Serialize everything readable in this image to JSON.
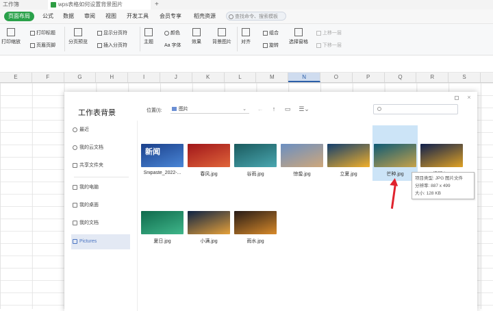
{
  "titlebar": {
    "tabs": [
      {
        "label": "工作簿"
      },
      {
        "label": "wps表格如何设置背景图片"
      }
    ],
    "new_tab": "+"
  },
  "menubar": {
    "items": [
      {
        "label": "页面布局",
        "active": true
      },
      {
        "label": "公式"
      },
      {
        "label": "数据"
      },
      {
        "label": "审阅"
      },
      {
        "label": "视图"
      },
      {
        "label": "开发工具"
      },
      {
        "label": "会员专享"
      },
      {
        "label": "稻壳资源"
      }
    ],
    "search_placeholder": "查找命令、搜索模板"
  },
  "ribbon": {
    "items": [
      {
        "label": "打印缩放",
        "icon": "print-scale-icon"
      },
      {
        "label": "打印标题",
        "icon": "print-title-icon"
      },
      {
        "label": "页眉页脚",
        "icon": "header-footer-icon"
      },
      {
        "label": "分页预览",
        "icon": "page-preview-icon"
      },
      {
        "label": "显示分页符",
        "icon": "show-pagebreak-checkbox"
      },
      {
        "label": "插入分页符",
        "icon": "insert-pagebreak-icon"
      },
      {
        "label": "主题",
        "icon": "theme-icon"
      },
      {
        "label": "颜色",
        "icon": "color-icon"
      },
      {
        "label": "Aa 字体",
        "icon": "font-icon"
      },
      {
        "label": "效果",
        "icon": "effect-icon"
      },
      {
        "label": "背景图片",
        "icon": "background-image-icon"
      },
      {
        "label": "对齐",
        "icon": "align-icon"
      },
      {
        "label": "组合",
        "icon": "group-icon"
      },
      {
        "label": "旋转",
        "icon": "rotate-icon"
      },
      {
        "label": "选择窗格",
        "icon": "selection-pane-icon"
      },
      {
        "label": "上移一层",
        "icon": "bring-forward-icon"
      },
      {
        "label": "下移一层",
        "icon": "send-backward-icon"
      }
    ]
  },
  "columns": [
    "E",
    "F",
    "G",
    "H",
    "I",
    "J",
    "K",
    "L",
    "M",
    "N",
    "O",
    "P",
    "Q",
    "R",
    "S"
  ],
  "selected_column": "N",
  "dialog": {
    "title": "工作表背景",
    "location_label": "位置(I):",
    "location_value": "图片",
    "sidebar": [
      {
        "label": "最近",
        "icon": "clock-icon"
      },
      {
        "label": "我的云文档",
        "icon": "cloud-icon"
      },
      {
        "label": "共享文件夹",
        "icon": "share-folder-icon"
      },
      {
        "label": "我的电脑",
        "icon": "computer-icon"
      },
      {
        "label": "我的桌面",
        "icon": "desktop-icon"
      },
      {
        "label": "我的文档",
        "icon": "documents-icon"
      },
      {
        "label": "Pictures",
        "icon": "pictures-folder-icon",
        "active": true
      }
    ],
    "files": [
      {
        "name": "Snipaste_2022-...",
        "thumb_text": "新闻",
        "colors": [
          "#1a3f8a",
          "#4a86d6"
        ]
      },
      {
        "name": "春风.jpg",
        "colors": [
          "#a0161a",
          "#e0653a"
        ]
      },
      {
        "name": "谷雨.jpg",
        "colors": [
          "#1a5a5e",
          "#4aa7b0"
        ]
      },
      {
        "name": "惊蛰.jpg",
        "colors": [
          "#6a8fc2",
          "#cfa77a"
        ]
      },
      {
        "name": "立夏.jpg",
        "colors": [
          "#123e6e",
          "#f2b02a"
        ]
      },
      {
        "name": "芒种.jpg",
        "colors": [
          "#0d5a75",
          "#c6a24a"
        ],
        "selected": true
      },
      {
        "name": "清明.jpg",
        "colors": [
          "#0e1f4d",
          "#e0a224"
        ]
      },
      {
        "name": "夏日.jpg",
        "colors": [
          "#0f6a4c",
          "#3fb68a"
        ]
      },
      {
        "name": "小满.jpg",
        "colors": [
          "#0d2243",
          "#e6a13a"
        ]
      },
      {
        "name": "雨水.jpg",
        "colors": [
          "#271b16",
          "#d88a2a"
        ]
      }
    ],
    "tooltip": {
      "line1": "项目类型: JPG 图片文件",
      "line2": "分辨率: 887 x 499",
      "line3": "大小: 128 KB"
    }
  },
  "colors": {
    "accent_green": "#2aa14a",
    "selection_blue": "#cce4f7",
    "arrow_red": "#e0232e"
  }
}
